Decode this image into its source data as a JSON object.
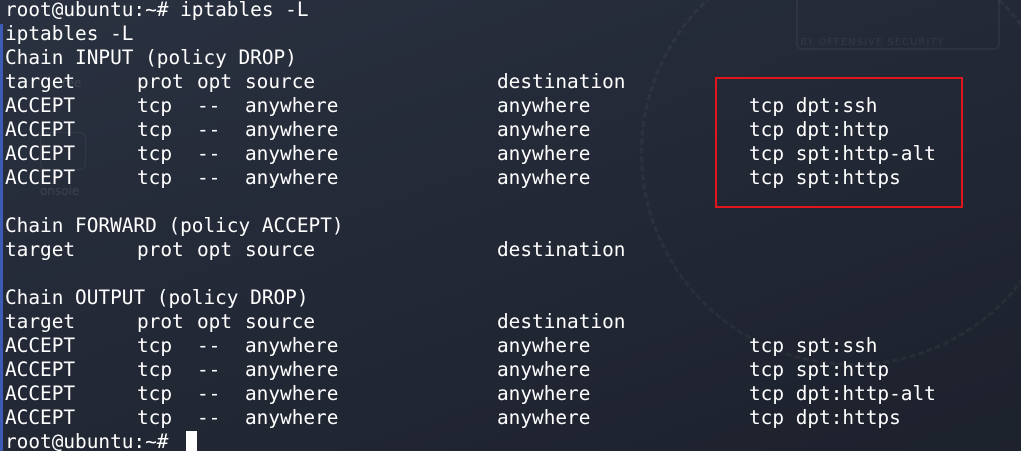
{
  "terminal": {
    "prompt_1": "root@ubuntu:~# iptables -L",
    "echo": "iptables -L",
    "input_chain": {
      "header": "Chain INPUT (policy DROP)",
      "columns": [
        "target",
        "prot",
        "opt",
        "source",
        "destination"
      ],
      "rules": [
        [
          "ACCEPT",
          "tcp",
          "--",
          "anywhere",
          "anywhere",
          "tcp dpt:ssh"
        ],
        [
          "ACCEPT",
          "tcp",
          "--",
          "anywhere",
          "anywhere",
          "tcp dpt:http"
        ],
        [
          "ACCEPT",
          "tcp",
          "--",
          "anywhere",
          "anywhere",
          "tcp spt:http-alt"
        ],
        [
          "ACCEPT",
          "tcp",
          "--",
          "anywhere",
          "anywhere",
          "tcp spt:https"
        ]
      ]
    },
    "forward_chain": {
      "header": "Chain FORWARD (policy ACCEPT)",
      "columns": [
        "target",
        "prot",
        "opt",
        "source",
        "destination"
      ]
    },
    "output_chain": {
      "header": "Chain OUTPUT (policy DROP)",
      "columns": [
        "target",
        "prot",
        "opt",
        "source",
        "destination"
      ],
      "rules": [
        [
          "ACCEPT",
          "tcp",
          "--",
          "anywhere",
          "anywhere",
          "tcp spt:ssh"
        ],
        [
          "ACCEPT",
          "tcp",
          "--",
          "anywhere",
          "anywhere",
          "tcp spt:http"
        ],
        [
          "ACCEPT",
          "tcp",
          "--",
          "anywhere",
          "anywhere",
          "tcp dpt:http-alt"
        ],
        [
          "ACCEPT",
          "tcp",
          "--",
          "anywhere",
          "anywhere",
          "tcp dpt:https"
        ]
      ]
    },
    "prompt_2": "root@ubuntu:~#",
    "highlight_color": "#e0161b",
    "background_color": "#232936",
    "text_color": "#ffffff"
  },
  "background_ghost": {
    "logo_text": "BY OFFENSIVE SECURITY",
    "ghost_1": "ree",
    "ghost_2": "onsole"
  }
}
